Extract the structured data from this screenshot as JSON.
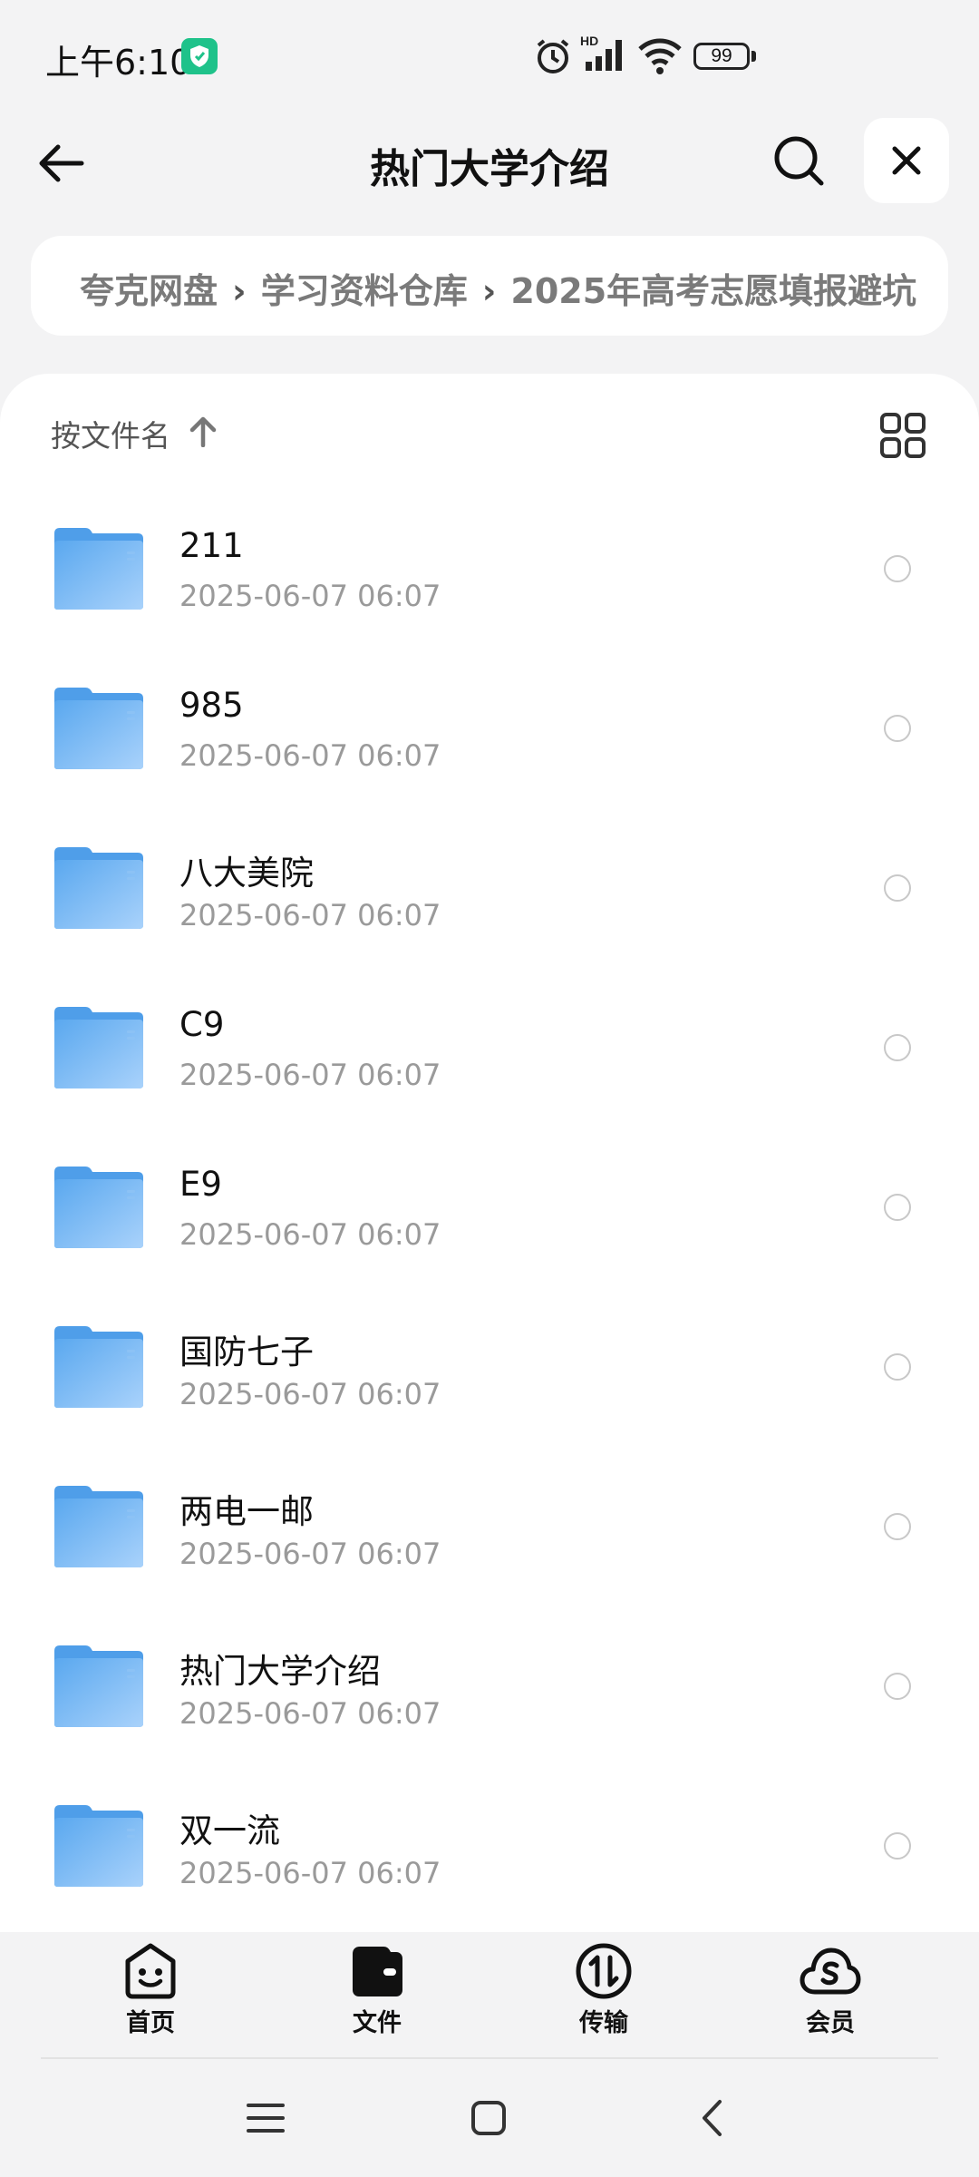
{
  "status_bar": {
    "time": "上午6:10",
    "battery": "99",
    "hd_label": "HD"
  },
  "header": {
    "title": "热门大学介绍"
  },
  "breadcrumb": {
    "items": [
      "夸克网盘",
      "学习资料仓库",
      "2025年高考志愿填报避坑"
    ],
    "separator": "›"
  },
  "sort": {
    "label": "按文件名"
  },
  "files": [
    {
      "name": "211",
      "date": "2025-06-07 06:07"
    },
    {
      "name": "985",
      "date": "2025-06-07 06:07"
    },
    {
      "name": "八大美院",
      "date": "2025-06-07 06:07"
    },
    {
      "name": "C9",
      "date": "2025-06-07 06:07"
    },
    {
      "name": "E9",
      "date": "2025-06-07 06:07"
    },
    {
      "name": "国防七子",
      "date": "2025-06-07 06:07"
    },
    {
      "name": "两电一邮",
      "date": "2025-06-07 06:07"
    },
    {
      "name": "热门大学介绍",
      "date": "2025-06-07 06:07"
    },
    {
      "name": "双一流",
      "date": "2025-06-07 06:07"
    }
  ],
  "bottom_nav": {
    "items": [
      {
        "label": "首页",
        "icon": "smile-face-icon"
      },
      {
        "label": "文件",
        "icon": "wallet-folder-icon"
      },
      {
        "label": "传输",
        "icon": "transfer-icon"
      },
      {
        "label": "会员",
        "icon": "cloud-member-icon"
      }
    ]
  },
  "colors": {
    "accent_folder": "#63adf0",
    "background": "#f3f3f4",
    "shield_green": "#1fc28a"
  }
}
